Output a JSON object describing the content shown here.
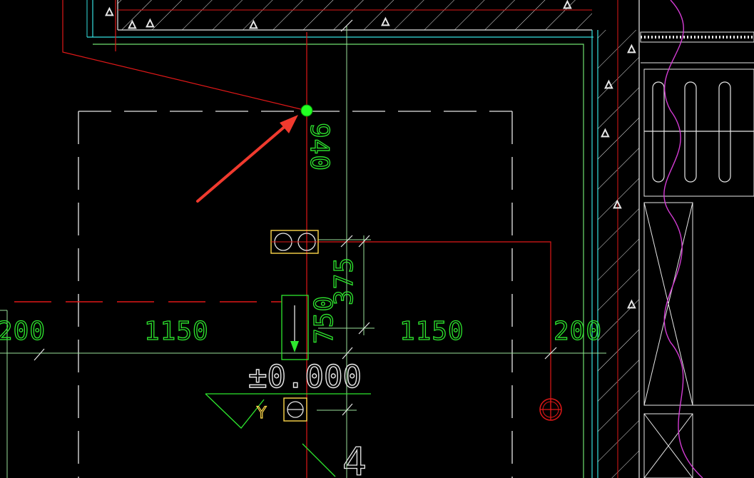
{
  "dimensions": {
    "left_200": "200",
    "left_1150": "1150",
    "right_1150": "1150",
    "right_200": "200",
    "vertical_940": "940",
    "vertical_750": "750",
    "vertical_375": "375"
  },
  "level_mark": "±0.000",
  "axis_tag": "Y",
  "grid_number": "4",
  "colors": {
    "background": "#000000",
    "red_line": "#e01818",
    "green_text": "#2ee62e",
    "white_line": "#e8e8e8",
    "cyan_wall": "#35e0e0",
    "yellow_symbol": "#ffd84a",
    "magenta_curve": "#d43cd4",
    "arrow": "#f03a2e",
    "marker_dot": "#22ff22"
  },
  "icons": {
    "pointer": "red-arrow-icon",
    "junction": "green-dot-icon",
    "socket": "double-circle-socket-icon",
    "light": "crosshair-circle-icon"
  }
}
